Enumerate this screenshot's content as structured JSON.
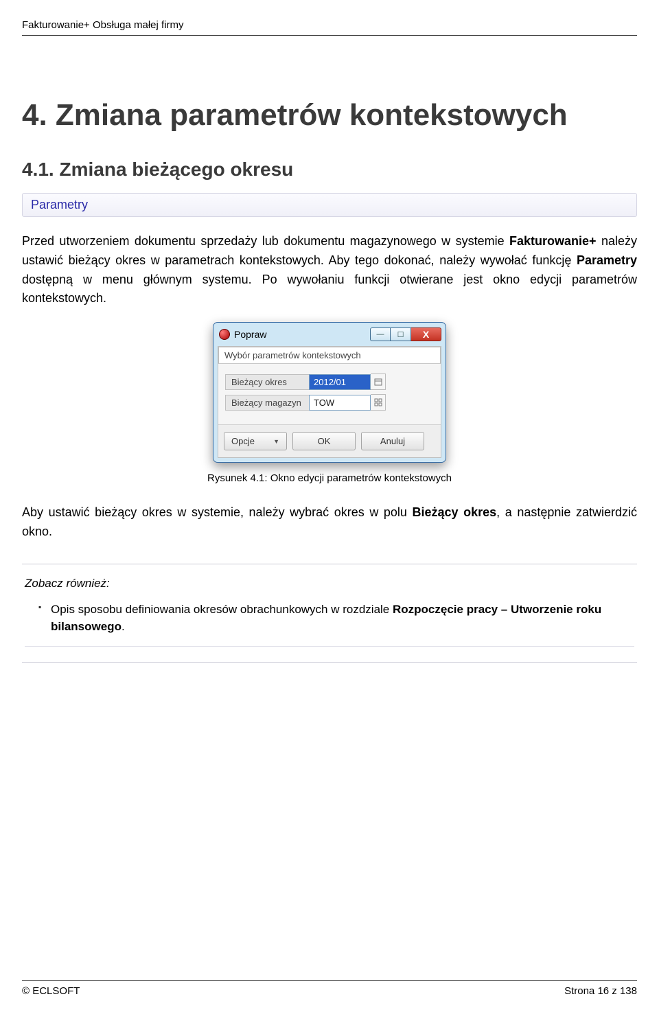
{
  "header": {
    "doc_title": "Fakturowanie+ Obsługa małej firmy"
  },
  "chapter": {
    "title": "4. Zmiana parametrów kontekstowych"
  },
  "section": {
    "title": "4.1. Zmiana bieżącego okresu"
  },
  "breadcrumb": {
    "text": "Parametry"
  },
  "paragraphs": {
    "p1_a": "Przed utworzeniem dokumentu sprzedaży lub dokumentu magazynowego w systemie ",
    "p1_b_bold": "Fakturowanie+",
    "p1_c": " należy ustawić bieżący okres w parametrach kontekstowych. Aby tego dokonać, należy wywołać funkcję ",
    "p1_d_bold": "Parametry",
    "p1_e": " dostępną w menu głównym systemu. Po wywołaniu funkcji otwierane jest okno edycji parametrów kontekstowych.",
    "p2_a": "Aby ustawić bieżący okres w systemie, należy wybrać okres w polu ",
    "p2_b_bold": "Bieżący okres",
    "p2_c": ", a następnie zatwierdzić okno."
  },
  "dialog": {
    "window_title": "Popraw",
    "heading": "Wybór parametrów kontekstowych",
    "rows": [
      {
        "label": "Bieżący okres",
        "value": "2012/01",
        "selected": true
      },
      {
        "label": "Bieżący magazyn",
        "value": "TOW",
        "selected": false
      }
    ],
    "buttons": {
      "opcje": "Opcje",
      "ok": "OK",
      "anuluj": "Anuluj"
    }
  },
  "figure": {
    "caption": "Rysunek 4.1: Okno edycji parametrów kontekstowych"
  },
  "info_box": {
    "label": "Zobacz również:",
    "item_a": "Opis sposobu definiowania okresów obrachunkowych w rozdziale ",
    "item_b_bold": "Rozpoczęcie pracy – Utworzenie roku bilansowego",
    "item_c": "."
  },
  "footer": {
    "left": "© ECLSOFT",
    "right": "Strona 16 z 138"
  }
}
